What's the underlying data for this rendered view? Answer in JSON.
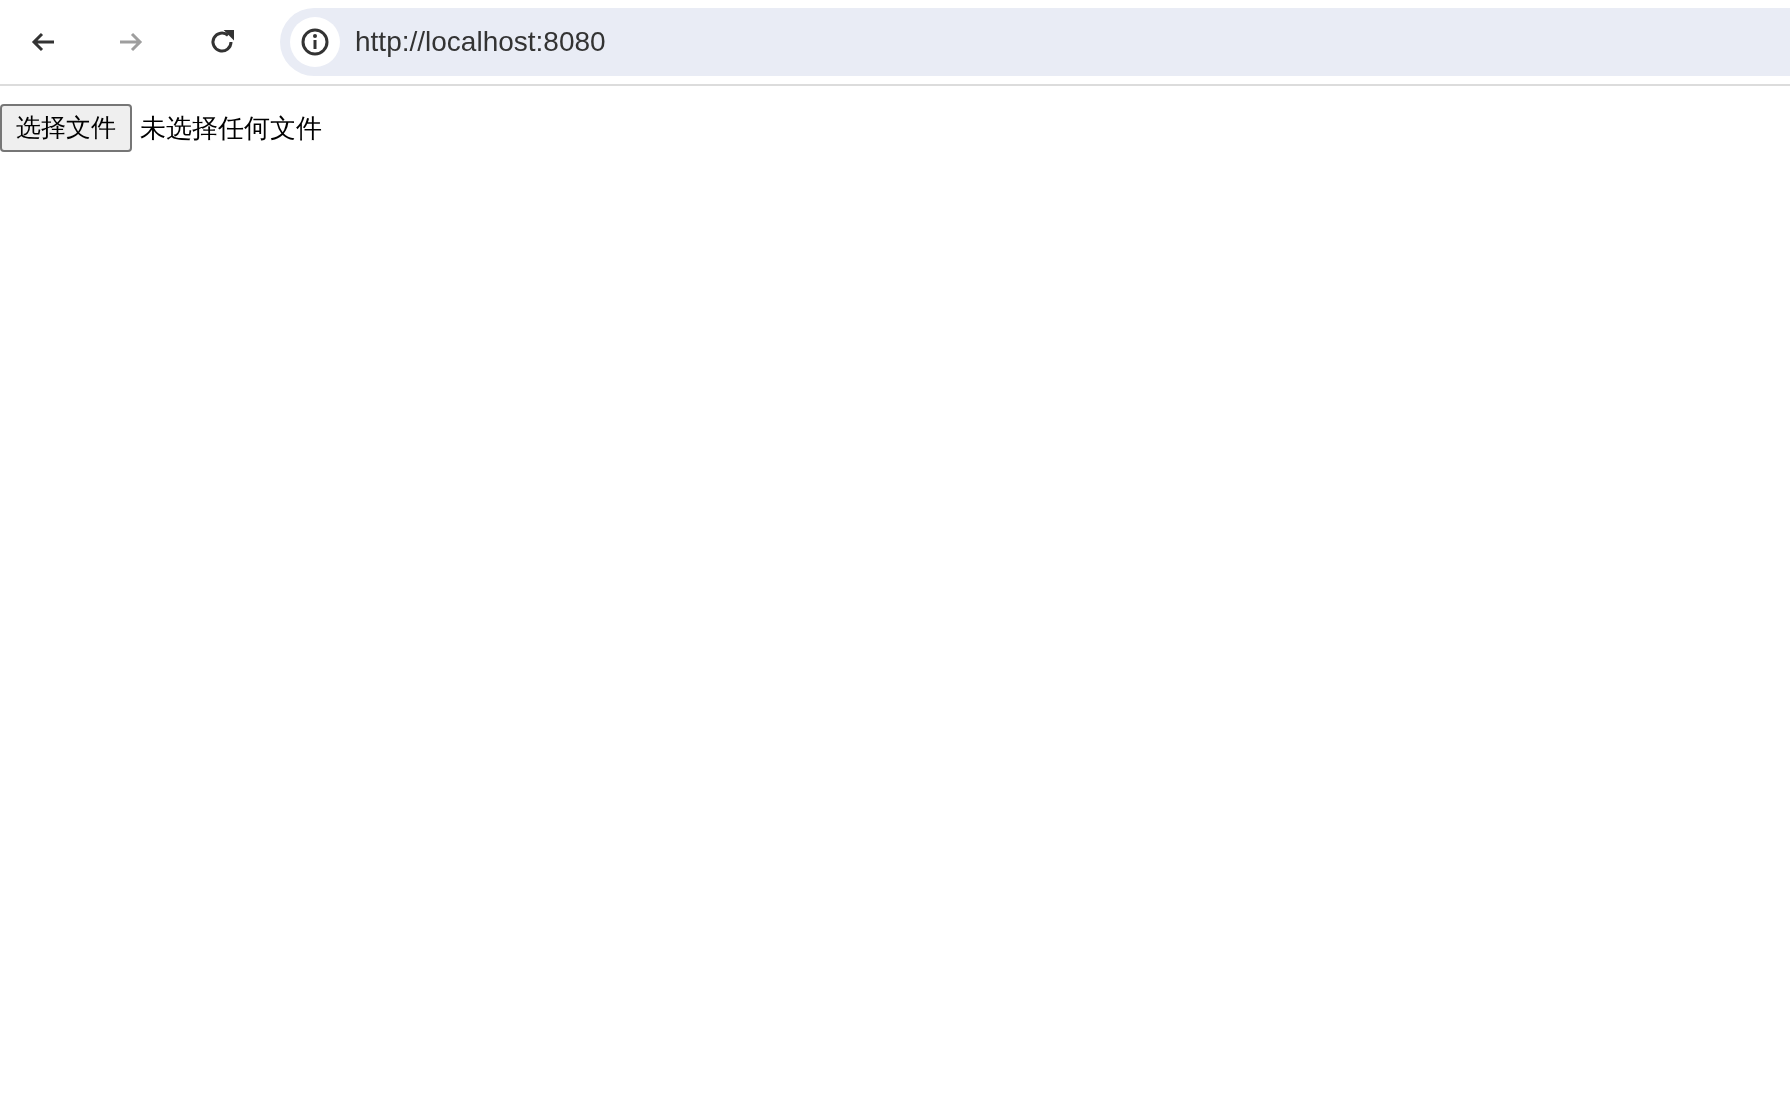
{
  "toolbar": {
    "nav_buttons": [
      {
        "kind": "back",
        "disabled": false
      },
      {
        "kind": "forward",
        "disabled": true
      },
      {
        "kind": "reload",
        "disabled": false
      }
    ],
    "address": "http://localhost:8080"
  },
  "page": {
    "file_input": {
      "button": "选择文件",
      "status": "未选择任何文件"
    }
  }
}
